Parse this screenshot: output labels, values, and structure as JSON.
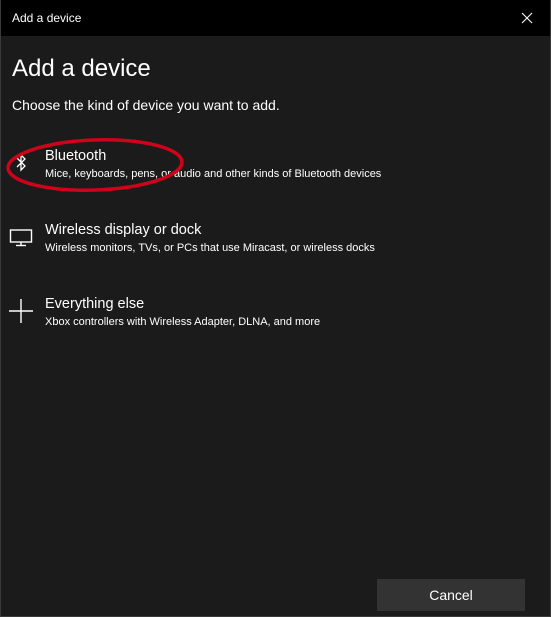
{
  "window": {
    "title": "Add a device"
  },
  "main": {
    "heading": "Add a device",
    "subheading": "Choose the kind of device you want to add."
  },
  "options": [
    {
      "icon": "bluetooth-icon",
      "label": "Bluetooth",
      "description": "Mice, keyboards, pens, or audio and other kinds of Bluetooth devices"
    },
    {
      "icon": "monitor-icon",
      "label": "Wireless display or dock",
      "description": "Wireless monitors, TVs, or PCs that use Miracast, or wireless docks"
    },
    {
      "icon": "plus-icon",
      "label": "Everything else",
      "description": "Xbox controllers with Wireless Adapter, DLNA, and more"
    }
  ],
  "footer": {
    "cancel_label": "Cancel"
  },
  "colors": {
    "background": "#1b1b1b",
    "titlebar": "#000000",
    "button": "#333333",
    "annotation": "#d0021b",
    "text": "#ffffff"
  }
}
